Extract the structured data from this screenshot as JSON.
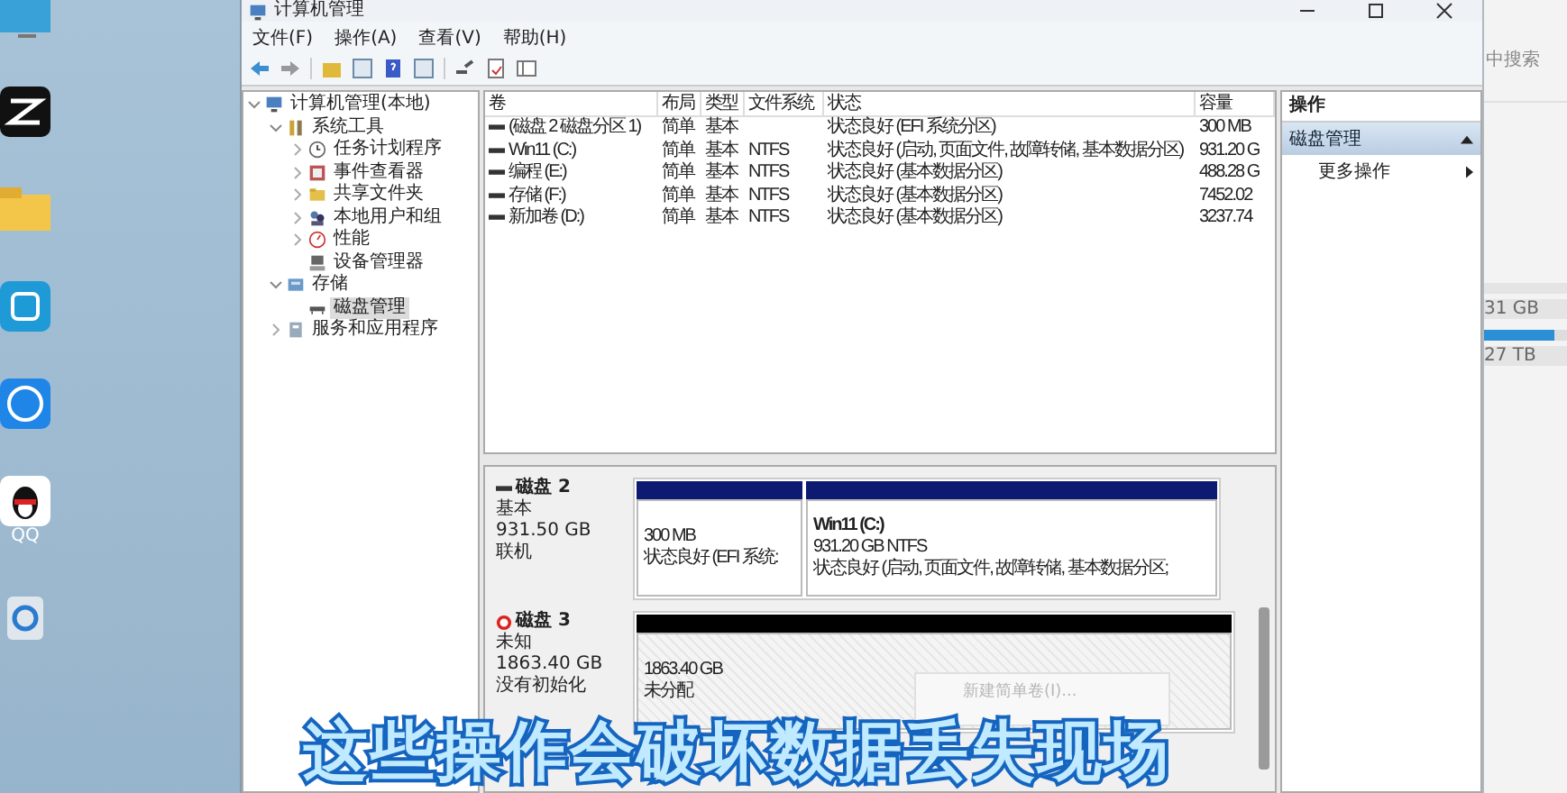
{
  "desktop": {
    "icons": [
      {
        "kind": "monitor"
      },
      {
        "kind": "capcut"
      },
      {
        "kind": "folder"
      },
      {
        "kind": "app"
      },
      {
        "kind": "k"
      },
      {
        "kind": "penguin",
        "label": "QQ"
      },
      {
        "kind": "recycle"
      }
    ]
  },
  "window": {
    "title": "计算机管理"
  },
  "menu": [
    "文件(F)",
    "操作(A)",
    "查看(V)",
    "帮助(H)"
  ],
  "tree": [
    {
      "label": "计算机管理(本地)",
      "kind": "computer",
      "expanded": true,
      "selected": false,
      "children": [
        {
          "label": "系统工具",
          "kind": "tools",
          "expanded": true,
          "selected": false,
          "children": [
            {
              "label": "任务计划程序",
              "kind": "clock",
              "expanded": false,
              "selected": false
            },
            {
              "label": "事件查看器",
              "kind": "log",
              "expanded": false,
              "selected": false
            },
            {
              "label": "共享文件夹",
              "kind": "folder",
              "expanded": false,
              "selected": false
            },
            {
              "label": "本地用户和组",
              "kind": "users",
              "expanded": false,
              "selected": false
            },
            {
              "label": "性能",
              "kind": "perf",
              "expanded": false,
              "selected": false
            },
            {
              "label": "设备管理器",
              "kind": "device",
              "selected": false
            }
          ]
        },
        {
          "label": "存储",
          "kind": "storage",
          "expanded": true,
          "selected": false,
          "children": [
            {
              "label": "磁盘管理",
              "kind": "disk",
              "selected": true
            }
          ]
        },
        {
          "label": "服务和应用程序",
          "kind": "services",
          "expanded": false,
          "selected": false
        }
      ]
    }
  ],
  "table": {
    "columns": [
      "卷",
      "布局",
      "类型",
      "文件系统",
      "状态",
      "容量"
    ],
    "rows": [
      [
        "(磁盘 2 磁盘分区 1)",
        "简单",
        "基本",
        "",
        "状态良好 (EFI 系统分区)",
        "300 MB"
      ],
      [
        "Win11 (C:)",
        "简单",
        "基本",
        "NTFS",
        "状态良好 (启动, 页面文件, 故障转储, 基本数据分区)",
        "931.20 G"
      ],
      [
        "编程 (E:)",
        "简单",
        "基本",
        "NTFS",
        "状态良好 (基本数据分区)",
        "488.28 G"
      ],
      [
        "存储 (F:)",
        "简单",
        "基本",
        "NTFS",
        "状态良好 (基本数据分区)",
        "7452.02"
      ],
      [
        "新加卷 (D:)",
        "简单",
        "基本",
        "NTFS",
        "状态良好 (基本数据分区)",
        "3237.74"
      ]
    ]
  },
  "disks": [
    {
      "name": "磁盘 2",
      "kind": "online",
      "type": "基本",
      "size": "931.50 GB",
      "state": "联机",
      "partitions": [
        {
          "kind": "primary",
          "size": "300 MB",
          "status": "状态良好 (EFI 系统:"
        },
        {
          "kind": "primary",
          "title": "Win11  (C:)",
          "size": "931.20 GB NTFS",
          "status": "状态良好 (启动, 页面文件, 故障转储, 基本数据分区;"
        }
      ]
    },
    {
      "name": "磁盘 3",
      "kind": "uninitialized",
      "type": "未知",
      "size": "1863.40 GB",
      "state": "没有初始化",
      "partitions": [
        {
          "kind": "unallocated",
          "size": "1863.40 GB",
          "status": "未分配"
        }
      ]
    }
  ],
  "context_menu": {
    "items": [
      {
        "label": "新建简单卷(I)...",
        "disabled": true
      }
    ]
  },
  "actions": {
    "title": "操作",
    "section": "磁盘管理",
    "items": [
      "更多操作"
    ]
  },
  "background_window": {
    "search": "中搜索",
    "drives": [
      {
        "text": "31 GB"
      },
      {
        "text": "27 TB",
        "level": 0.85
      }
    ]
  },
  "subtitle": "这些操作会破坏数据丢失现场"
}
